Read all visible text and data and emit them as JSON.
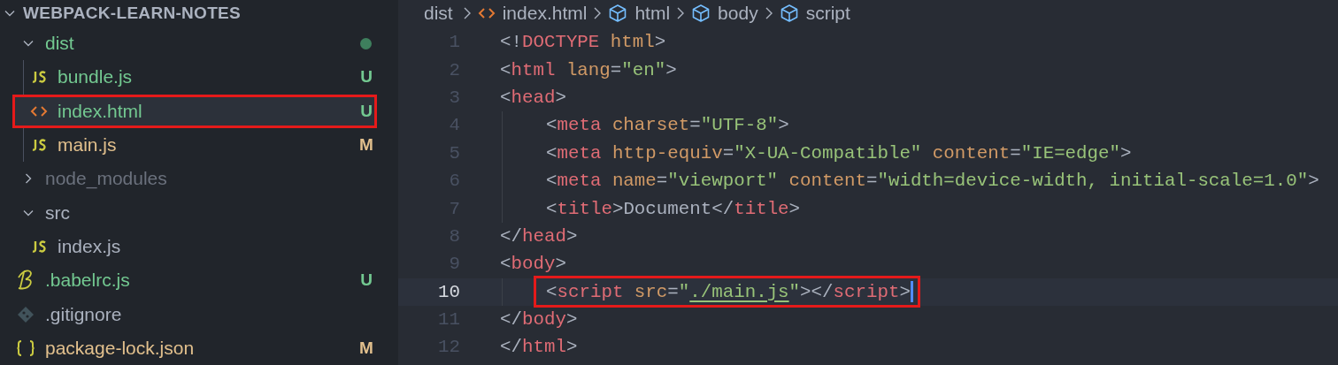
{
  "explorer": {
    "title": "WEBPACK-LEARN-NOTES",
    "expanded": true,
    "items": [
      {
        "name": "dist",
        "kind": "folder",
        "expanded": true,
        "color": "#73c991",
        "dot": true,
        "selected": false,
        "annotated": false,
        "children": [
          {
            "name": "bundle.js",
            "kind": "js",
            "color": "#73c991",
            "badge": "U",
            "selected": false,
            "annotated": false
          },
          {
            "name": "index.html",
            "kind": "html",
            "color": "#73c991",
            "badge": "U",
            "selected": true,
            "annotated": true
          },
          {
            "name": "main.js",
            "kind": "js",
            "color": "#e2c08d",
            "badge": "M",
            "selected": false,
            "annotated": false
          }
        ]
      },
      {
        "name": "node_modules",
        "kind": "folder",
        "expanded": false,
        "color": "#6b717d",
        "dot": false,
        "selected": false,
        "annotated": false
      },
      {
        "name": "src",
        "kind": "folder",
        "expanded": true,
        "color": "#abb2bf",
        "dot": false,
        "selected": false,
        "annotated": false,
        "children": [
          {
            "name": "index.js",
            "kind": "js",
            "color": "#abb2bf",
            "selected": false,
            "annotated": false
          }
        ]
      },
      {
        "name": ".babelrc.js",
        "kind": "babel",
        "color": "#73c991",
        "badge": "U",
        "selected": false,
        "annotated": false
      },
      {
        "name": ".gitignore",
        "kind": "git",
        "color": "#abb2bf",
        "selected": false,
        "annotated": false
      },
      {
        "name": "package-lock.json",
        "kind": "json",
        "color": "#e2c08d",
        "badge": "M",
        "selected": false,
        "annotated": false
      }
    ]
  },
  "breadcrumbs": [
    {
      "label": "dist",
      "kind": "folder"
    },
    {
      "label": "index.html",
      "kind": "html"
    },
    {
      "label": "html",
      "kind": "element"
    },
    {
      "label": "body",
      "kind": "element"
    },
    {
      "label": "script",
      "kind": "element"
    }
  ],
  "editor": {
    "lines": [
      {
        "number": "1",
        "text": "<!DOCTYPE html>",
        "indented": false,
        "current": false,
        "annotated": false
      },
      {
        "number": "2",
        "text": "<html lang=\"en\">",
        "indented": false,
        "current": false,
        "annotated": false,
        "link_underlined": false
      },
      {
        "number": "3",
        "text": "<head>",
        "indented": false,
        "current": false,
        "annotated": false
      },
      {
        "number": "4",
        "text": "<meta charset=\"UTF-8\">",
        "indented": true,
        "current": false,
        "annotated": false,
        "link_underlined": false
      },
      {
        "number": "5",
        "text": "<meta http-equiv=\"X-UA-Compatible\" content=\"IE=edge\">",
        "indented": true,
        "current": false,
        "annotated": false,
        "link_underlined": false
      },
      {
        "number": "6",
        "text": "<meta name=\"viewport\" content=\"width=device-width, initial-scale=1.0\">",
        "indented": true,
        "current": false,
        "annotated": false,
        "link_underlined": false
      },
      {
        "number": "7",
        "text": "<title>Document</title>",
        "indented": true,
        "current": false,
        "annotated": false,
        "link_underlined": false
      },
      {
        "number": "8",
        "text": "</head>",
        "indented": false,
        "current": false,
        "annotated": false
      },
      {
        "number": "9",
        "text": "<body>",
        "indented": false,
        "current": false,
        "annotated": false
      },
      {
        "number": "10",
        "text": "<script src=\"./main.js\"></script>",
        "indented": true,
        "current": true,
        "annotated": true,
        "link_underlined": true
      },
      {
        "number": "11",
        "text": "</body>",
        "indented": false,
        "current": false,
        "annotated": false
      },
      {
        "number": "12",
        "text": "</html>",
        "indented": false,
        "current": false,
        "annotated": false
      }
    ]
  }
}
